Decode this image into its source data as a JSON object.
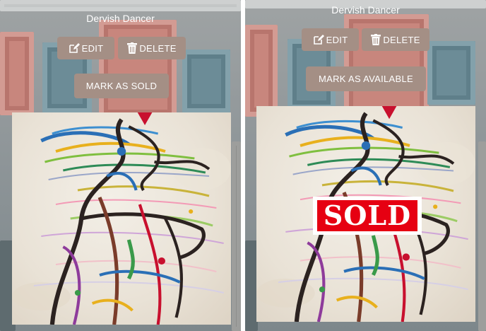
{
  "colors": {
    "button_bg": "#a48f85",
    "sold_red": "#e60012",
    "text": "#ffffff"
  },
  "panels": [
    {
      "title": "Dervish Dancer",
      "edit_label": "EDIT",
      "delete_label": "DELETE",
      "toggle_label": "MARK AS SOLD",
      "edit_icon": "edit-icon",
      "delete_icon": "trash-icon",
      "sold": false
    },
    {
      "title": "Dervish Dancer",
      "edit_label": "EDIT",
      "delete_label": "DELETE",
      "toggle_label": "MARK AS AVAILABLE",
      "edit_icon": "edit-icon",
      "delete_icon": "trash-icon",
      "sold": true,
      "sold_badge": "SOLD"
    }
  ]
}
